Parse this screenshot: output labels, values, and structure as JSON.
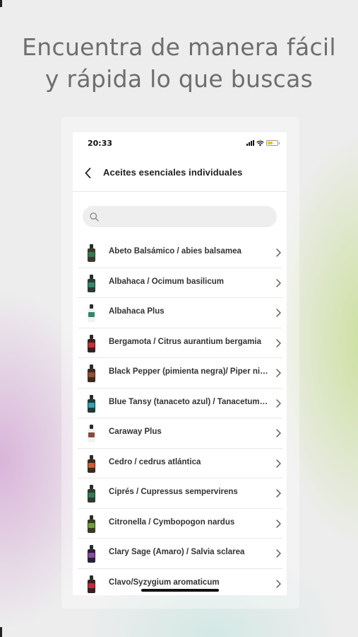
{
  "headline": {
    "line1": "Encuentra de manera fácil",
    "line2": "y rápida lo que buscas"
  },
  "status_bar": {
    "time": "20:33",
    "battery_color": "#f3c316"
  },
  "navbar": {
    "back_icon": "chevron-left-icon",
    "title": "Aceites esenciales individuales"
  },
  "search": {
    "icon": "search-icon",
    "placeholder": "",
    "value": ""
  },
  "items": [
    {
      "label": "Abeto Balsámico / abies balsamea",
      "bottle_color": "#3a3a2a",
      "label_color": "#2e7d4f"
    },
    {
      "label": "Albahaca / Ocimum basilicum",
      "bottle_color": "#2d3a35",
      "label_color": "#2f8a6a"
    },
    {
      "label": "Albahaca Plus",
      "bottle_color": "#f2f2f2",
      "label_color": "#2f8a6a"
    },
    {
      "label": "Bergamota / Citrus aurantium bergamia",
      "bottle_color": "#3a2020",
      "label_color": "#d8283a"
    },
    {
      "label": "Black Pepper (pimienta negra)/ Piper nigrum",
      "bottle_color": "#3a2a20",
      "label_color": "#9a4e2a"
    },
    {
      "label": "Blue Tansy (tanaceto azul) / Tanacetum annuum",
      "bottle_color": "#203a3a",
      "label_color": "#2aa7b5"
    },
    {
      "label": "Caraway Plus",
      "bottle_color": "#f2f2f2",
      "label_color": "#8a4a3a"
    },
    {
      "label": "Cedro / cedrus atlántica",
      "bottle_color": "#3a2a20",
      "label_color": "#d65a2a"
    },
    {
      "label": "Ciprés / Cupressus sempervirens",
      "bottle_color": "#2d3a35",
      "label_color": "#2e7d4f"
    },
    {
      "label": "Citronella / Cymbopogon nardus",
      "bottle_color": "#3a3a20",
      "label_color": "#6aa23a"
    },
    {
      "label": "Clary Sage (Amaro) / Salvia sclarea",
      "bottle_color": "#2a203a",
      "label_color": "#8a4aa8"
    },
    {
      "label": "Clavo/Syzygium aromaticum",
      "bottle_color": "#3a2020",
      "label_color": "#c8283a"
    }
  ],
  "row_chevron_icon": "chevron-right-icon"
}
